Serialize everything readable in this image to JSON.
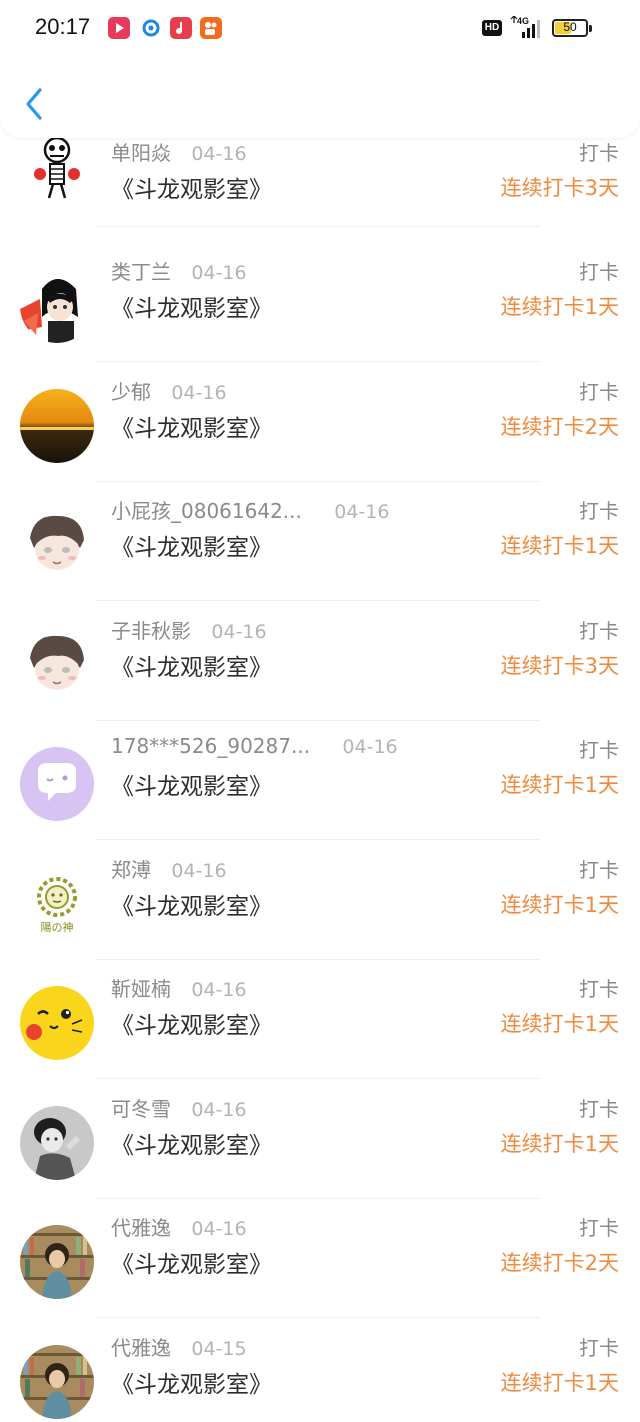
{
  "status_bar": {
    "time": "20:17",
    "hd_label": "HD",
    "network": "4G",
    "battery": "50",
    "battery_level": 0.5,
    "app_icons": [
      "video-app-icon",
      "browser-app-icon",
      "music-app-icon",
      "kuaishou-app-icon"
    ]
  },
  "header": {
    "back_icon": "chevron-left-icon",
    "accent_color": "#1e9bea"
  },
  "colors": {
    "streak": "#f08a3e",
    "username": "#8a8a8a",
    "date": "#b4b4b4",
    "title": "#2d2d2d"
  },
  "records": [
    {
      "username": "单阳焱",
      "date": "04-16",
      "title": "《斗龙观影室》",
      "action": "打卡",
      "streak": "连续打卡3天",
      "avatar": "skeleton-boxer-avatar"
    },
    {
      "username": "类丁兰",
      "date": "04-16",
      "title": "《斗龙观影室》",
      "action": "打卡",
      "streak": "连续打卡1天",
      "avatar": "anime-boy-avatar"
    },
    {
      "username": "少郁",
      "date": "04-16",
      "title": "《斗龙观影室》",
      "action": "打卡",
      "streak": "连续打卡2天",
      "avatar": "sunset-avatar"
    },
    {
      "username": "小屁孩_08061642...",
      "date": "04-16",
      "title": "《斗龙观影室》",
      "action": "打卡",
      "streak": "连续打卡1天",
      "avatar": "cartoon-boy-avatar"
    },
    {
      "username": "子非秋影",
      "date": "04-16",
      "title": "《斗龙观影室》",
      "action": "打卡",
      "streak": "连续打卡3天",
      "avatar": "cartoon-boy-avatar"
    },
    {
      "username": "178***526_90287...",
      "date": "04-16",
      "title": "《斗龙观影室》",
      "action": "打卡",
      "streak": "连续打卡1天",
      "avatar": "chat-bubble-avatar"
    },
    {
      "username": "郑溥",
      "date": "04-16",
      "title": "《斗龙观影室》",
      "action": "打卡",
      "streak": "连续打卡1天",
      "avatar": "sun-god-avatar"
    },
    {
      "username": "靳娅楠",
      "date": "04-16",
      "title": "《斗龙观影室》",
      "action": "打卡",
      "streak": "连续打卡1天",
      "avatar": "pikachu-avatar"
    },
    {
      "username": "可冬雪",
      "date": "04-16",
      "title": "《斗龙观影室》",
      "action": "打卡",
      "streak": "连续打卡1天",
      "avatar": "bw-girl-avatar"
    },
    {
      "username": "代雅逸",
      "date": "04-16",
      "title": "《斗龙观影室》",
      "action": "打卡",
      "streak": "连续打卡2天",
      "avatar": "bookshelf-girl-avatar"
    },
    {
      "username": "代雅逸",
      "date": "04-15",
      "title": "《斗龙观影室》",
      "action": "打卡",
      "streak": "连续打卡1天",
      "avatar": "bookshelf-girl-avatar"
    }
  ]
}
